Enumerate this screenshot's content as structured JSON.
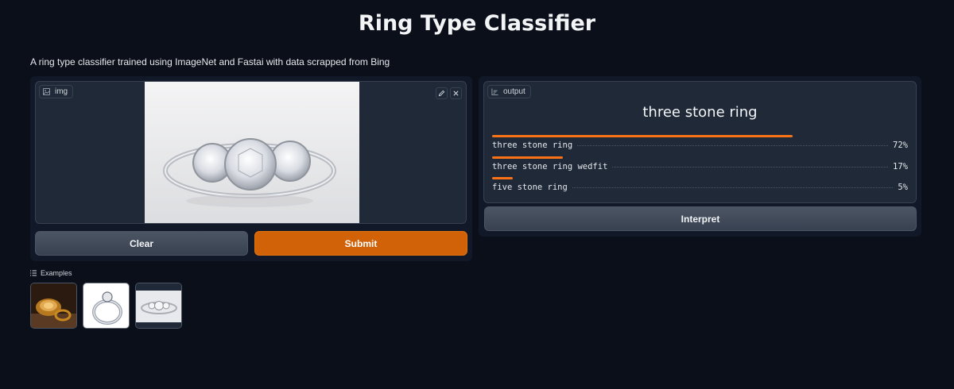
{
  "page": {
    "title": "Ring Type Classifier",
    "description": "A ring type classifier trained using ImageNet and Fastai with data scrapped from Bing"
  },
  "input": {
    "label": "img",
    "icons": [
      "image-icon",
      "edit-icon",
      "close-icon"
    ]
  },
  "buttons": {
    "clear": "Clear",
    "submit": "Submit",
    "interpret": "Interpret"
  },
  "output": {
    "label": "output",
    "prediction": "three stone ring",
    "confidences": [
      {
        "label": "three stone ring",
        "percent_text": "72%",
        "value": 0.72
      },
      {
        "label": "three stone ring wedfit",
        "percent_text": "17%",
        "value": 0.17
      },
      {
        "label": "five stone ring",
        "percent_text": "5%",
        "value": 0.05
      }
    ]
  },
  "examples": {
    "label": "Examples",
    "items": [
      "gold-signet-ring",
      "solitaire-ring",
      "three-stone-ring"
    ]
  },
  "colors": {
    "background": "#0b0f19",
    "panel": "#111827",
    "accent": "#d26208",
    "bar": "#f97316"
  }
}
